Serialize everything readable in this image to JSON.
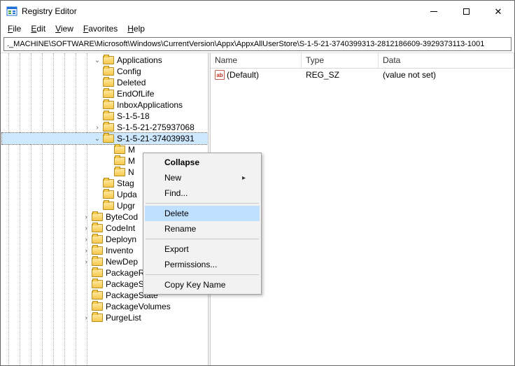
{
  "window": {
    "title": "Registry Editor"
  },
  "menu": {
    "file": "File",
    "edit": "Edit",
    "view": "View",
    "favorites": "Favorites",
    "help": "Help"
  },
  "address": "._MACHINE\\SOFTWARE\\Microsoft\\Windows\\CurrentVersion\\Appx\\AppxAllUserStore\\S-1-5-21-3740399313-2812186609-3929373113-1001",
  "tree": {
    "items": [
      {
        "depth": 8,
        "tw": "down",
        "label": "Applications"
      },
      {
        "depth": 8,
        "tw": "",
        "label": "Config"
      },
      {
        "depth": 8,
        "tw": "",
        "label": "Deleted"
      },
      {
        "depth": 8,
        "tw": "",
        "label": "EndOfLife"
      },
      {
        "depth": 8,
        "tw": "",
        "label": "InboxApplications"
      },
      {
        "depth": 8,
        "tw": "",
        "label": "S-1-5-18"
      },
      {
        "depth": 8,
        "tw": "right",
        "label": "S-1-5-21-275937068"
      },
      {
        "depth": 8,
        "tw": "down",
        "label": "S-1-5-21-374039931",
        "sel": true
      },
      {
        "depth": 9,
        "tw": "",
        "label": "M"
      },
      {
        "depth": 9,
        "tw": "",
        "label": "M"
      },
      {
        "depth": 9,
        "tw": "",
        "label": "N"
      },
      {
        "depth": 8,
        "tw": "",
        "label": "Stag"
      },
      {
        "depth": 8,
        "tw": "",
        "label": "Upda"
      },
      {
        "depth": 8,
        "tw": "",
        "label": "Upgr"
      },
      {
        "depth": 7,
        "tw": "right",
        "label": "ByteCod"
      },
      {
        "depth": 7,
        "tw": "right",
        "label": "CodeInt"
      },
      {
        "depth": 7,
        "tw": "right",
        "label": "Deployn"
      },
      {
        "depth": 7,
        "tw": "right",
        "label": "Invento"
      },
      {
        "depth": 7,
        "tw": "right",
        "label": "NewDep"
      },
      {
        "depth": 7,
        "tw": "",
        "label": "PackageRepair"
      },
      {
        "depth": 7,
        "tw": "",
        "label": "PackageSidRef"
      },
      {
        "depth": 7,
        "tw": "",
        "label": "PackageState"
      },
      {
        "depth": 7,
        "tw": "",
        "label": "PackageVolumes"
      },
      {
        "depth": 7,
        "tw": "right",
        "label": "PurgeList"
      }
    ]
  },
  "list": {
    "columns": {
      "name": "Name",
      "type": "Type",
      "data": "Data"
    },
    "rows": [
      {
        "name": "(Default)",
        "type": "REG_SZ",
        "data": "(value not set)"
      }
    ]
  },
  "context_menu": {
    "collapse": "Collapse",
    "new": "New",
    "find": "Find...",
    "delete": "Delete",
    "rename": "Rename",
    "export": "Export",
    "permissions": "Permissions...",
    "copy_key_name": "Copy Key Name"
  }
}
